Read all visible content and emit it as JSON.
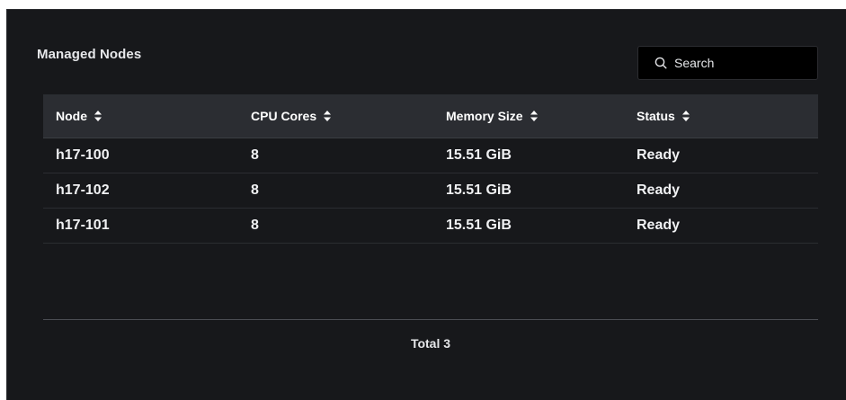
{
  "panel": {
    "title": "Managed Nodes"
  },
  "search": {
    "placeholder": "Search",
    "icon": "search-icon"
  },
  "table": {
    "columns": [
      {
        "label": "Node",
        "sort_icon": "sort-icon"
      },
      {
        "label": "CPU Cores",
        "sort_icon": "sort-icon"
      },
      {
        "label": "Memory Size",
        "sort_icon": "sort-icon"
      },
      {
        "label": "Status",
        "sort_icon": "sort-icon"
      }
    ],
    "rows": [
      {
        "node": "h17-100",
        "cpu": "8",
        "memory": "15.51 GiB",
        "status": "Ready"
      },
      {
        "node": "h17-102",
        "cpu": "8",
        "memory": "15.51 GiB",
        "status": "Ready"
      },
      {
        "node": "h17-101",
        "cpu": "8",
        "memory": "15.51 GiB",
        "status": "Ready"
      }
    ]
  },
  "footer": {
    "total_label": "Total 3"
  },
  "colors": {
    "panel_background": "#17181b",
    "header_background": "#2b2d32",
    "search_background": "#000000",
    "text": "#f0f1f3"
  }
}
